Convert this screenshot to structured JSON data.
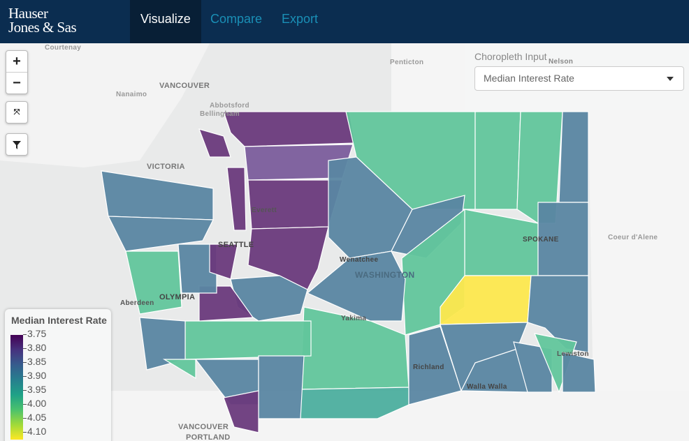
{
  "nav": {
    "logo": "Hauser Jones & Sas",
    "logo_line1": "Hauser",
    "logo_line2": "Jones & Sas",
    "tabs": [
      {
        "label": "Visualize",
        "active": true
      },
      {
        "label": "Compare",
        "active": false
      },
      {
        "label": "Export",
        "active": false
      }
    ]
  },
  "controls": {
    "zoom_in": "+",
    "zoom_out": "−",
    "fit_icon": "expand-icon",
    "filter_icon": "filter-icon"
  },
  "choropleth": {
    "label": "Choropleth Input",
    "selected": "Median Interest Rate"
  },
  "legend": {
    "title": "Median Interest Rate",
    "ticks": [
      "3.75",
      "3.80",
      "3.85",
      "3.90",
      "3.95",
      "4.00",
      "4.05",
      "4.10"
    ],
    "colors": {
      "low": "#440154",
      "high": "#fde725"
    }
  },
  "colors": {
    "purple": "#6a3a7c",
    "lightpurple": "#7b5d9c",
    "blue": "#5a86a2",
    "green": "#62c69c",
    "teal": "#4cae9e",
    "yellow": "#fde84e"
  },
  "cities": [
    "Courtenay",
    "Penticton",
    "Nelson",
    "Nanaimo",
    "VANCOUVER",
    "Abbotsford",
    "Bellingham",
    "VICTORIA",
    "Everett",
    "SEATTLE",
    "Wenatchee",
    "WASHINGTON",
    "SPOKANE",
    "Coeur d'Alene",
    "Aberdeen",
    "OLYMPIA",
    "Yakima",
    "Richland",
    "Walla Walla",
    "Lewiston",
    "VANCOUVER",
    "PORTLAND"
  ]
}
